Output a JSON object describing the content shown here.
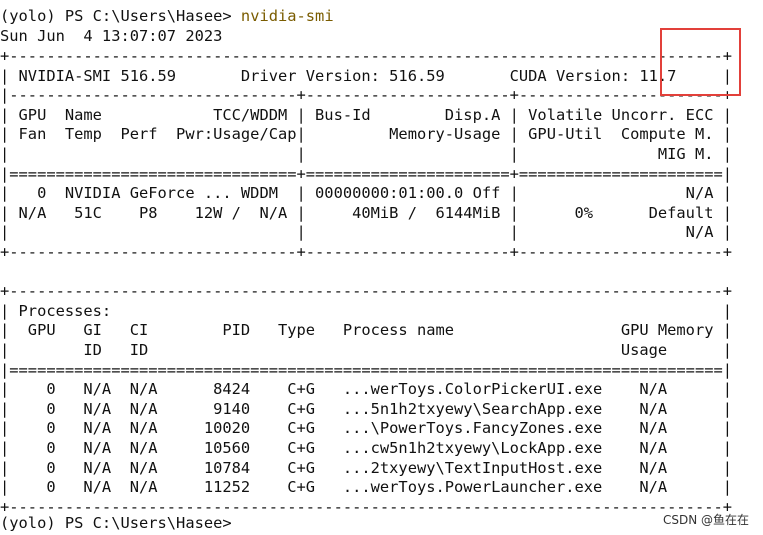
{
  "terminal": {
    "prompt_before": "(yolo) PS C:\\Users\\Hasee> ",
    "command": "nvidia-smi",
    "timestamp": "Sun Jun  4 13:07:07 2023",
    "smi_lines": [
      "+-----------------------------------------------------------------------------+",
      "| NVIDIA-SMI 516.59       Driver Version: 516.59       CUDA Version: 11.7     |",
      "|-------------------------------+----------------------+----------------------+",
      "| GPU  Name            TCC/WDDM | Bus-Id        Disp.A | Volatile Uncorr. ECC |",
      "| Fan  Temp  Perf  Pwr:Usage/Cap|         Memory-Usage | GPU-Util  Compute M. |",
      "|                               |                      |               MIG M. |",
      "|===============================+======================+======================|",
      "|   0  NVIDIA GeForce ... WDDM  | 00000000:01:00.0 Off |                  N/A |",
      "| N/A   51C    P8    12W /  N/A |     40MiB /  6144MiB |      0%      Default |",
      "|                               |                      |                  N/A |",
      "+-------------------------------+----------------------+----------------------+",
      "",
      "+-----------------------------------------------------------------------------+",
      "| Processes:                                                                  |",
      "|  GPU   GI   CI        PID   Type   Process name                  GPU Memory |",
      "|        ID   ID                                                   Usage      |",
      "|=============================================================================|",
      "|    0   N/A  N/A      8424    C+G   ...werToys.ColorPickerUI.exe    N/A      |",
      "|    0   N/A  N/A      9140    C+G   ...5n1h2txyewy\\SearchApp.exe    N/A      |",
      "|    0   N/A  N/A     10020    C+G   ...\\PowerToys.FancyZones.exe    N/A      |",
      "|    0   N/A  N/A     10560    C+G   ...cw5n1h2txyewy\\LockApp.exe    N/A      |",
      "|    0   N/A  N/A     10784    C+G   ...2txyewy\\TextInputHost.exe    N/A      |",
      "|    0   N/A  N/A     11252    C+G   ...werToys.PowerLauncher.exe    N/A      |",
      "+-----------------------------------------------------------------------------+"
    ],
    "prompt_after": "(yolo) PS C:\\Users\\Hasee> "
  },
  "watermark": "CSDN @鱼在在",
  "colors": {
    "background": "#ffffff",
    "text": "#111111",
    "command": "#7a5c00",
    "highlight": "#e2403a"
  }
}
